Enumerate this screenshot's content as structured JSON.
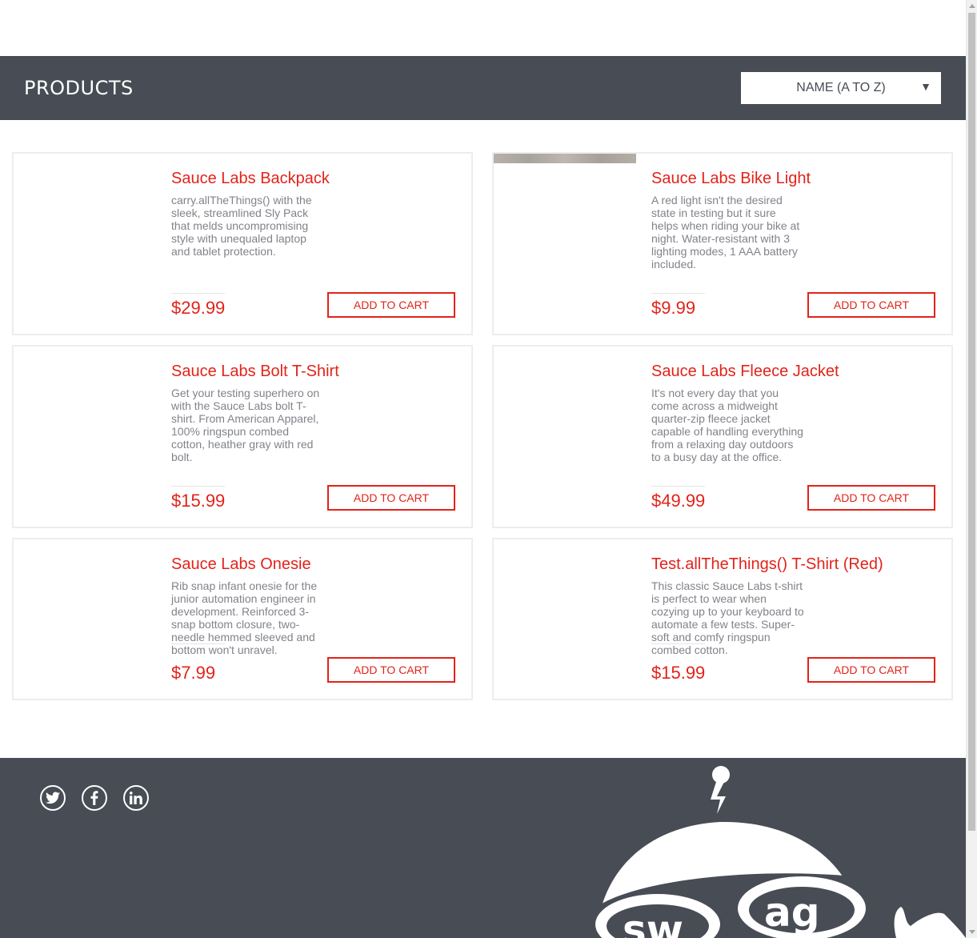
{
  "header": {
    "title": "PRODUCTS",
    "sort": {
      "selected": "NAME (A TO Z)",
      "caret": "▼"
    }
  },
  "products": [
    {
      "name": "Sauce Labs Backpack",
      "description": "carry.allTheThings() with the sleek, streamlined Sly Pack that melds uncompromising style with unequaled laptop and tablet protection.",
      "price": "$29.99",
      "button": "ADD TO CART"
    },
    {
      "name": "Sauce Labs Bike Light",
      "description": "A red light isn't the desired state in testing but it sure helps when riding your bike at night. Water-resistant with 3 lighting modes, 1 AAA battery included.",
      "price": "$9.99",
      "button": "ADD TO CART"
    },
    {
      "name": "Sauce Labs Bolt T-Shirt",
      "description": "Get your testing superhero on with the Sauce Labs bolt T-shirt. From American Apparel, 100% ringspun combed cotton, heather gray with red bolt.",
      "price": "$15.99",
      "button": "ADD TO CART"
    },
    {
      "name": "Sauce Labs Fleece Jacket",
      "description": "It's not every day that you come across a midweight quarter-zip fleece jacket capable of handling everything from a relaxing day outdoors to a busy day at the office.",
      "price": "$49.99",
      "button": "ADD TO CART"
    },
    {
      "name": "Sauce Labs Onesie",
      "description": "Rib snap infant onesie for the junior automation engineer in development. Reinforced 3-snap bottom closure, two-needle hemmed sleeved and bottom won't unravel.",
      "price": "$7.99",
      "button": "ADD TO CART"
    },
    {
      "name": "Test.allTheThings() T-Shirt (Red)",
      "description": "This classic Sauce Labs t-shirt is perfect to wear when cozying up to your keyboard to automate a few tests. Super-soft and comfy ringspun combed cotton.",
      "price": "$15.99",
      "button": "ADD TO CART"
    }
  ],
  "footer": {
    "social": [
      "twitter-icon",
      "facebook-icon",
      "linkedin-icon"
    ],
    "mascot_text": "swag"
  },
  "colors": {
    "accent": "#e2231a",
    "header_bg": "#474c55",
    "text_muted": "#81838a"
  }
}
